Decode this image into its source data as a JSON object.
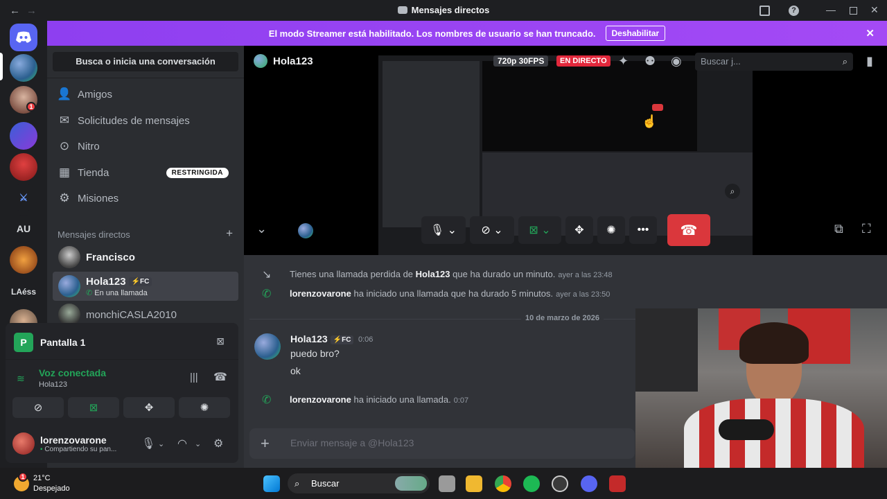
{
  "titlebar": {
    "title": "Mensajes directos",
    "back_icon": "←",
    "forward_icon": "→"
  },
  "banner": {
    "text": "El modo Streamer está habilitado. Los nombres de usuario se han truncado.",
    "button": "Deshabilitar"
  },
  "servers": {
    "au": "AU",
    "laess": "LAéss",
    "badge_count": "1"
  },
  "sidebar": {
    "search": "Busca o inicia una conversación",
    "nav": [
      {
        "label": "Amigos"
      },
      {
        "label": "Solicitudes de mensajes"
      },
      {
        "label": "Nitro"
      },
      {
        "label": "Tienda",
        "badge": "RESTRINGIDA"
      },
      {
        "label": "Misiones"
      }
    ],
    "dm_header": "Mensajes directos",
    "dms": [
      {
        "name": "Francisco"
      },
      {
        "name": "Hola123",
        "tag": "⚡FC",
        "status": "En una llamada"
      },
      {
        "name": "monchiCASLA2010"
      }
    ]
  },
  "voice_panel": {
    "screen_label": "Pantalla 1",
    "status": "Voz conectada",
    "channel": "Hola123",
    "user_name": "lorenzovarone",
    "user_status": "Compartiendo su pan..."
  },
  "stage": {
    "channel_name": "Hola123",
    "quality": "720p 30FPS",
    "live": "EN DIRECTO",
    "search_placeholder": "Buscar j..."
  },
  "chat": {
    "sys1_text1": "Tienes una llamada perdida de",
    "sys1_name": "Hola123",
    "sys1_text2": "que ha durado un minuto.",
    "sys1_time": "ayer a las 23:48",
    "sys2_name": "lorenzovarone",
    "sys2_text": "ha iniciado una llamada que ha durado 5 minutos.",
    "sys2_time": "ayer a las 23:50",
    "date": "10 de marzo de 2026",
    "msg_author": "Hola123",
    "msg_tag": "⚡FC",
    "msg_time": "0:06",
    "msg_lines": [
      "puedo bro?",
      "ok"
    ],
    "sys3_name": "lorenzovarone",
    "sys3_text": "ha iniciado una llamada.",
    "sys3_time": "0:07",
    "composer_placeholder": "Enviar mensaje a @Hola123"
  },
  "taskbar": {
    "temp": "21°C",
    "weather": "Despejado",
    "search": "Buscar",
    "weather_badge": "1"
  },
  "colors": {
    "brand": "#5865f2",
    "banner": "#9b3df0",
    "green": "#23a559",
    "red": "#da373c"
  }
}
